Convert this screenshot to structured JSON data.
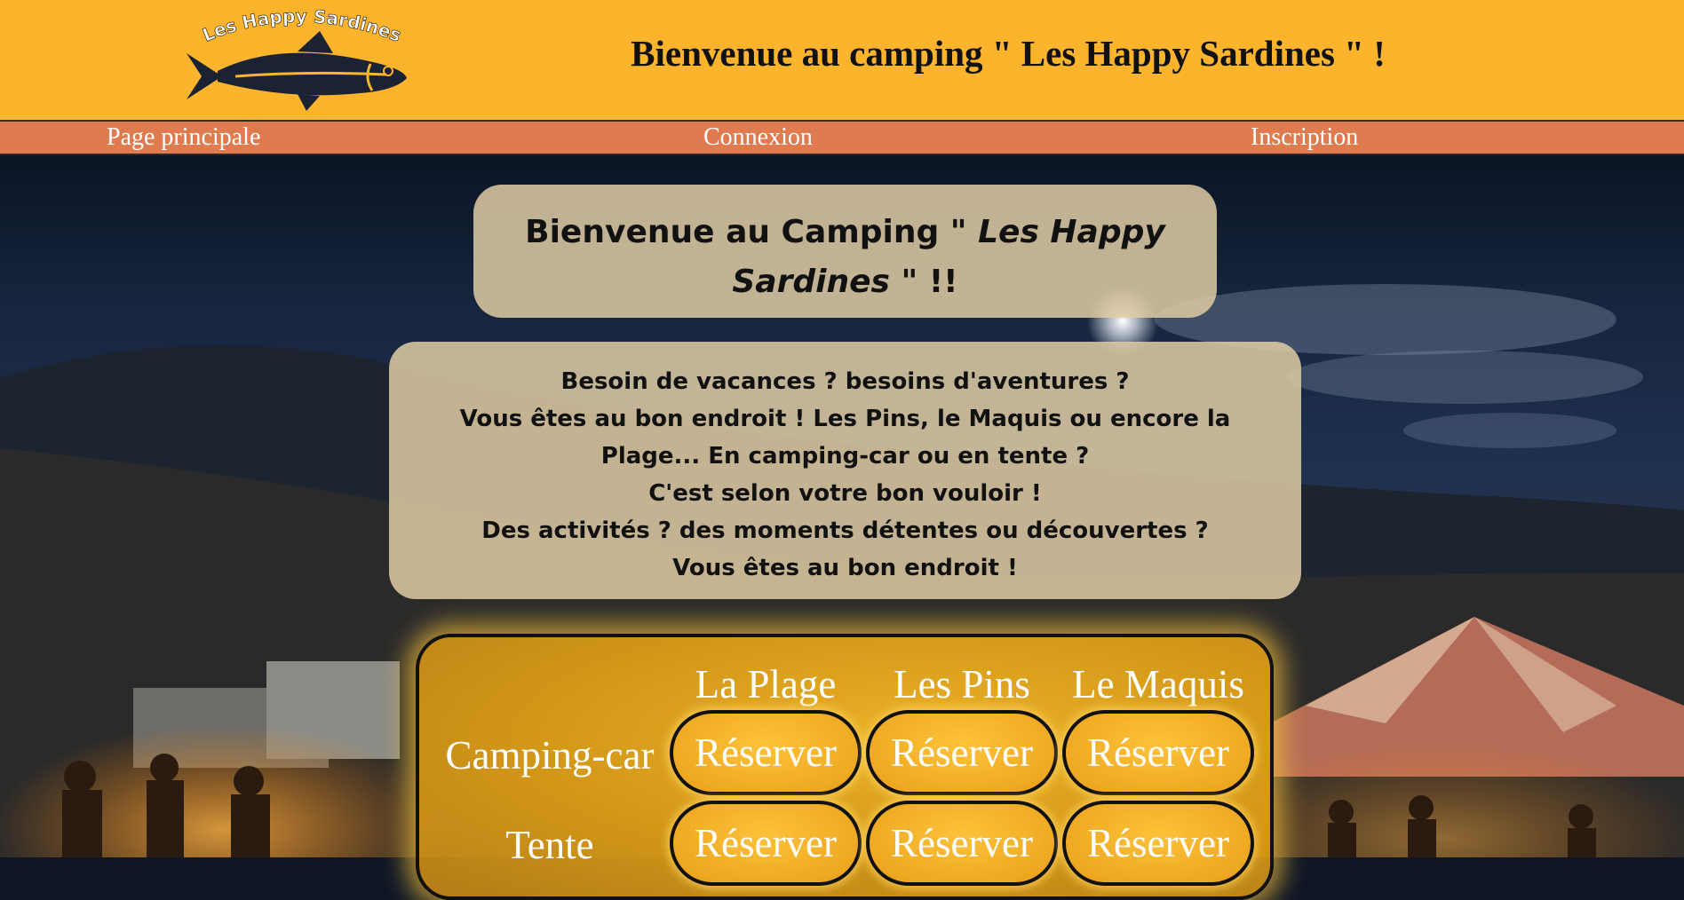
{
  "header": {
    "logo_text": "Les Happy Sardines",
    "title": "Bienvenue au camping \" Les Happy Sardines \" !"
  },
  "nav": {
    "home": "Page principale",
    "login": "Connexion",
    "signup": "Inscription"
  },
  "welcome": {
    "prefix": "Bienvenue au Camping \" ",
    "name_line1": "Les Happy",
    "name_line2": "Sardines",
    "suffix": " \" !!"
  },
  "description": {
    "lines": [
      "Besoin de vacances ? besoins d'aventures ?",
      "Vous êtes au bon endroit ! Les Pins, le Maquis ou encore la",
      "Plage... En camping-car ou en tente ?",
      "C'est selon votre bon vouloir !",
      "Des activités ? des moments détentes ou découvertes ?",
      "Vous êtes au bon endroit !"
    ]
  },
  "reservation": {
    "columns": [
      "La Plage",
      "Les Pins",
      "Le Maquis"
    ],
    "rows": [
      "Camping-car",
      "Tente"
    ],
    "button_label": "Réserver"
  },
  "colors": {
    "header_bg": "#fcb42c",
    "nav_bg": "#e07b4f",
    "box_bg": "#e1cda5",
    "button_gold": "#f5b020"
  }
}
